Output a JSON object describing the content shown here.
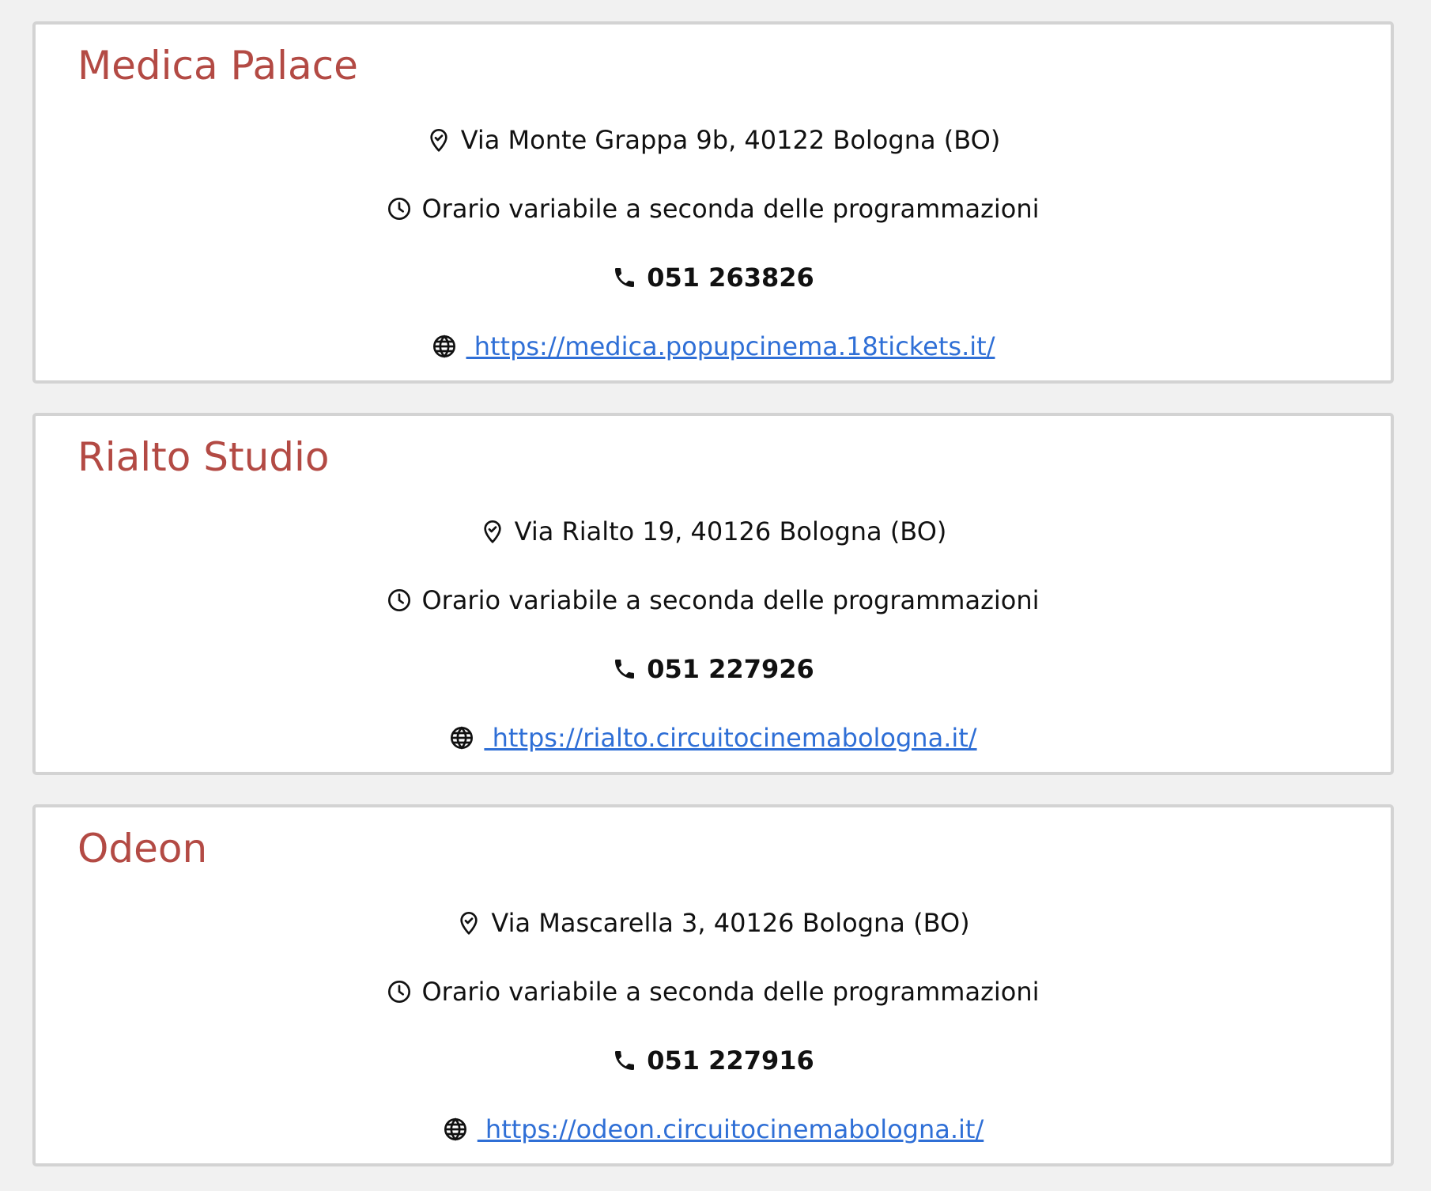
{
  "colors": {
    "page_background": "#f1f1f1",
    "card_background": "#ffffff",
    "card_border": "#d3d3d3",
    "title": "#b34a44",
    "text": "#111111",
    "link": "#2f6fd6"
  },
  "icons": {
    "address": "map-pin-icon",
    "hours": "clock-icon",
    "phone": "phone-icon",
    "website": "globe-icon"
  },
  "cinemas": [
    {
      "name": "Medica Palace",
      "address": "Via Monte Grappa 9b, 40122 Bologna (BO)",
      "hours": "Orario variabile a seconda delle programmazioni",
      "phone": "051 263826",
      "website": " https://medica.popupcinema.18tickets.it/"
    },
    {
      "name": "Rialto Studio",
      "address": "Via Rialto 19, 40126 Bologna (BO)",
      "hours": "Orario variabile a seconda delle programmazioni",
      "phone": "051 227926",
      "website": " https://rialto.circuitocinemabologna.it/"
    },
    {
      "name": "Odeon",
      "address": "Via Mascarella 3, 40126 Bologna (BO)",
      "hours": "Orario variabile a seconda delle programmazioni",
      "phone": "051 227916",
      "website": " https://odeon.circuitocinemabologna.it/"
    }
  ]
}
